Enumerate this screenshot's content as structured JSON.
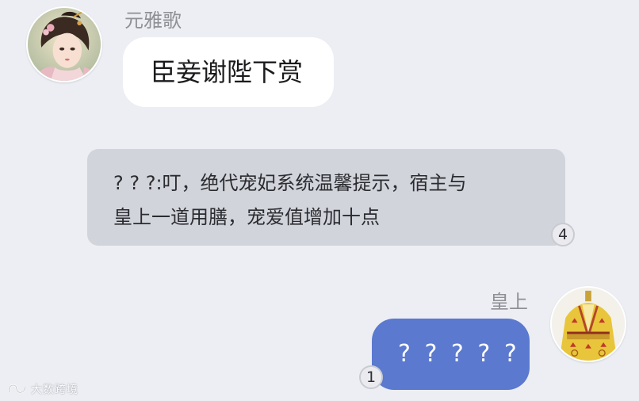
{
  "messages": {
    "received": {
      "sender": "元雅歌",
      "text": "臣妾谢陛下赏",
      "avatar": "woman-portrait-avatar"
    },
    "system": {
      "line1": "? ? ?:叮，绝代宠妃系统温馨提示，宿主与",
      "line2": "皇上一道用膳，宠爱值增加十点",
      "badge": "4"
    },
    "sent": {
      "sender": "皇上",
      "text": "? ? ? ? ?",
      "badge": "1",
      "avatar": "emperor-robe-avatar"
    }
  },
  "watermark": {
    "text": "大数跨境",
    "logo": "watermark-logo"
  },
  "colors": {
    "background": "#eceef3",
    "received_bubble": "#ffffff",
    "system_bubble": "#d2d4dc",
    "sent_bubble": "#5a79cf",
    "sender_name": "#8e9096"
  }
}
